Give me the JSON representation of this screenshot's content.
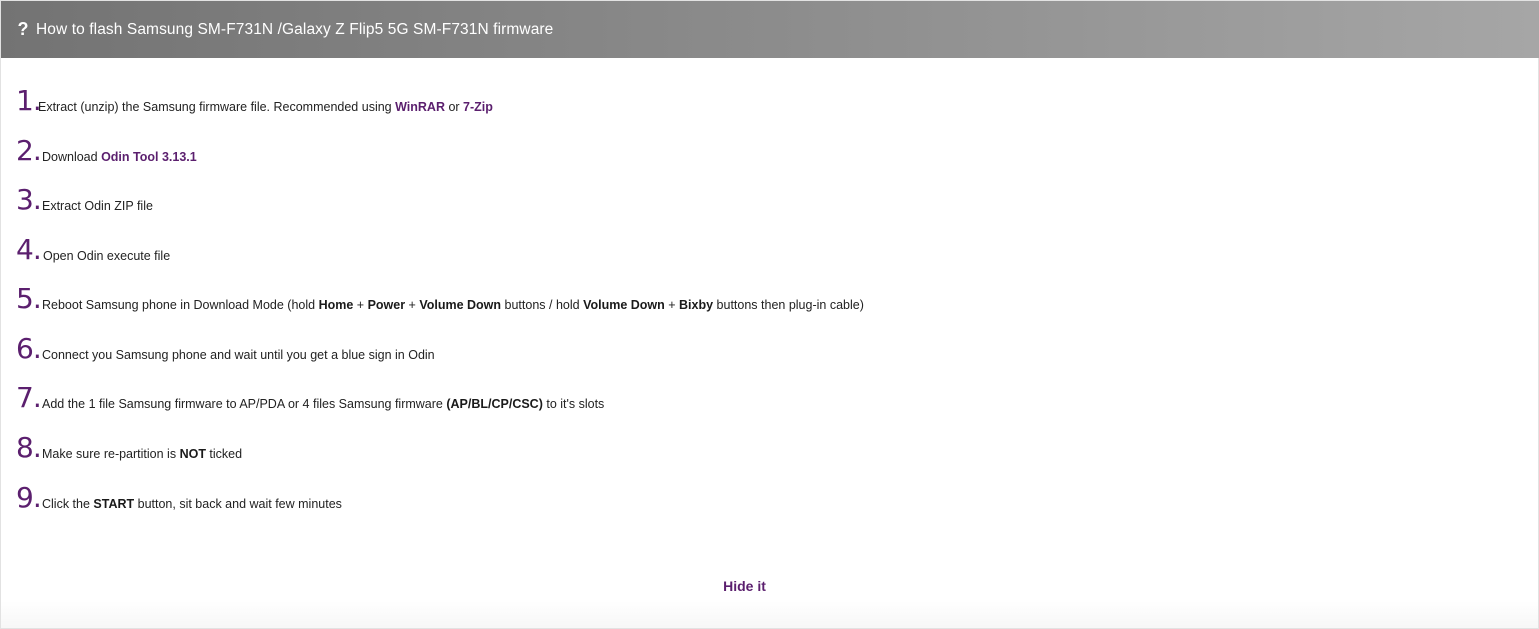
{
  "header": {
    "icon": "question-mark-icon",
    "icon_glyph": "?",
    "title": "How to flash Samsung SM-F731N /Galaxy Z Flip5 5G SM-F731N firmware"
  },
  "steps": [
    {
      "number": "1.",
      "text_a": "Extract (unzip) the Samsung firmware file. Recommended using ",
      "link1": "WinRAR",
      "text_b": " or ",
      "link2": "7-Zip"
    },
    {
      "number": "2.",
      "text_a": "Download ",
      "link1": "Odin Tool 3.13.1"
    },
    {
      "number": "3.",
      "text_a": "Extract Odin ZIP file"
    },
    {
      "number": "4.",
      "text_a": "Open Odin execute file"
    },
    {
      "number": "5.",
      "text_a": "Reboot Samsung phone in Download Mode (hold ",
      "bold1": "Home",
      "text_b": " + ",
      "bold2": "Power",
      "text_c": " + ",
      "bold3": "Volume Down",
      "text_d": " buttons / hold ",
      "bold4": "Volume Down",
      "text_e": " + ",
      "bold5": "Bixby",
      "text_f": " buttons then plug-in cable)"
    },
    {
      "number": "6.",
      "text_a": "Connect you Samsung phone and wait until you get a blue sign in Odin"
    },
    {
      "number": "7.",
      "text_a": "Add the 1 file Samsung firmware to AP/PDA or 4 files Samsung firmware ",
      "bold1": "(AP/BL/CP/CSC)",
      "text_b": " to it's slots"
    },
    {
      "number": "8.",
      "text_a": "Make sure re-partition is ",
      "bold1": "NOT",
      "text_b": " ticked"
    },
    {
      "number": "9.",
      "text_a": "Click the ",
      "bold1": "START",
      "text_b": " button, sit back and wait few minutes"
    }
  ],
  "footer": {
    "hide_label": "Hide it"
  },
  "colors": {
    "accent": "#5b1f6e",
    "header_start": "#737373",
    "header_end": "#a6a6a6",
    "text": "#222222"
  }
}
